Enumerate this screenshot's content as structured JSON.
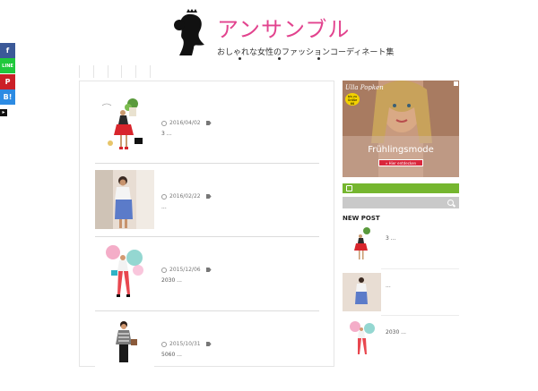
{
  "header": {
    "title": "アンサンブル",
    "subtitle": "おしゃれな女性のファッションコーディネート集"
  },
  "share": {
    "facebook_icon": "f",
    "line_icon": "LINE",
    "pinterest_icon": "P",
    "hatena_icon": "B!"
  },
  "posts": [
    {
      "date": "2016/04/02",
      "excerpt": "3 ..."
    },
    {
      "date": "2016/02/22",
      "excerpt": "..."
    },
    {
      "date": "2015/12/06",
      "excerpt": "2030 ..."
    },
    {
      "date": "2015/10/31",
      "excerpt": "5060 ..."
    }
  ],
  "ad": {
    "brand": "Ulla Popken",
    "badge": "bis zu Größe 66",
    "headline": "Frühlingsmode",
    "cta": "» Hier entdecken"
  },
  "sidebar": {
    "new_post_title": "NEW POST",
    "items": [
      {
        "text": "3 ..."
      },
      {
        "text": "..."
      },
      {
        "text": "2030 ..."
      }
    ]
  },
  "colors": {
    "brand_pink": "#e2438e",
    "rss_green": "#75b62f",
    "search_gray": "#c9c9c9"
  }
}
